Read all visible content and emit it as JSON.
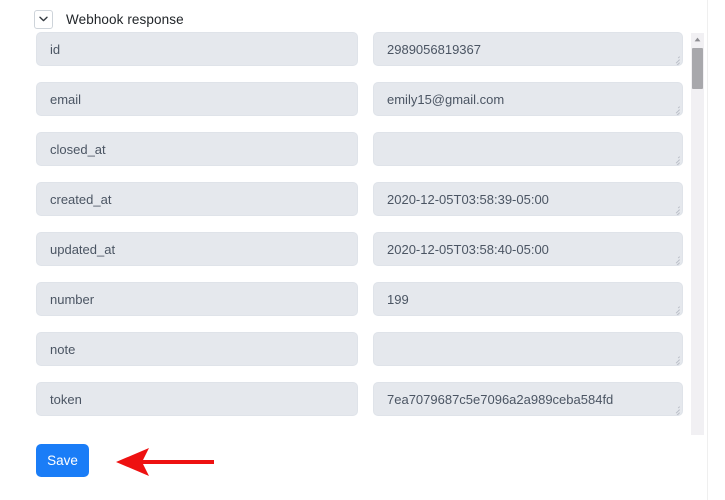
{
  "section": {
    "title": "Webhook response",
    "collapse_icon": "chevron-down-icon",
    "expanded": true
  },
  "fields": [
    {
      "key": "id",
      "value": "2989056819367"
    },
    {
      "key": "email",
      "value": "emily15@gmail.com"
    },
    {
      "key": "closed_at",
      "value": ""
    },
    {
      "key": "created_at",
      "value": "2020-12-05T03:58:39-05:00"
    },
    {
      "key": "updated_at",
      "value": "2020-12-05T03:58:40-05:00"
    },
    {
      "key": "number",
      "value": "199"
    },
    {
      "key": "note",
      "value": ""
    },
    {
      "key": "token",
      "value": "7ea7079687c5e7096a2a989ceba584fd"
    }
  ],
  "actions": {
    "save_label": "Save",
    "save_color": "#1a7df7"
  },
  "scrollbar": {
    "up_arrow_icon": "caret-up-icon",
    "orientation": "vertical"
  },
  "annotation": {
    "arrow_icon": "arrow-left-icon",
    "color": "#ee1111",
    "points_to": "Save"
  },
  "colors": {
    "field_fill": "#e5e8ed",
    "field_border": "#dfe3e9",
    "field_text": "#4b5563",
    "title_text": "#212529",
    "accent": "#1a7df7",
    "annotation": "#ee1111",
    "scroll_track": "#f1f0f3",
    "scroll_thumb": "#a8a8ac"
  }
}
